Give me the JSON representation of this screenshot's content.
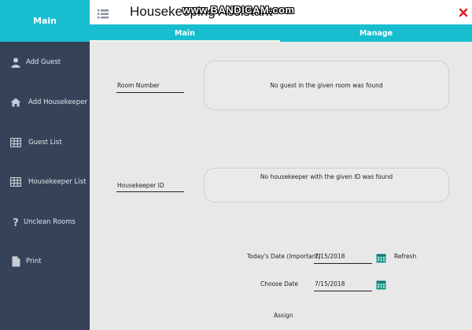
{
  "sidebar": {
    "header": "Main",
    "items": [
      {
        "label": "Add Guest",
        "icon": "user-icon"
      },
      {
        "label": "Add Housekeeper",
        "icon": "home-icon"
      },
      {
        "label": "Guest List",
        "icon": "table-icon"
      },
      {
        "label": "Housekeeper List",
        "icon": "table-icon"
      },
      {
        "label": "Unclean Rooms",
        "icon": "question-icon"
      },
      {
        "label": "Print",
        "icon": "document-icon"
      }
    ]
  },
  "header": {
    "title": "Housekeeping Assistant",
    "watermark": "www.BANDICAM.com"
  },
  "tabs": [
    {
      "label": "Main",
      "active": true
    },
    {
      "label": "Manage",
      "active": false
    }
  ],
  "main": {
    "room": {
      "label": "Room Number",
      "result": "No guest in the given room was found"
    },
    "housekeeper": {
      "label": "Housekeeper ID",
      "result": "No housekeeper with the given ID was found"
    },
    "today_date": {
      "label": "Today's Date (Important)",
      "value": "7/15/2018",
      "refresh_label": "Refresh"
    },
    "choose_date": {
      "label": "Choose Date",
      "value": "7/15/2018"
    },
    "assign_label": "Assign"
  },
  "colors": {
    "accent": "#17becf",
    "sidebar": "#354257",
    "background": "#e8e8e9",
    "close": "#e0202a",
    "calendar": "#1a9a8a"
  }
}
